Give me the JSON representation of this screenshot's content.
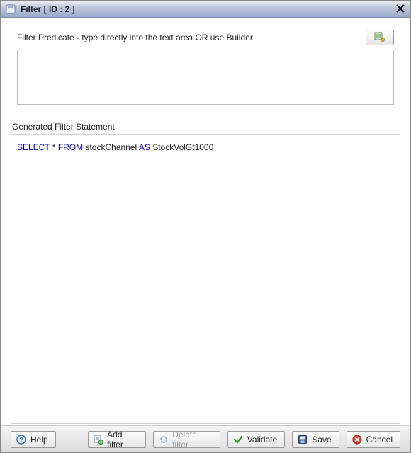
{
  "window": {
    "title": "Filter  [ ID : 2 ]"
  },
  "predicate": {
    "label": "Filter Predicate - type directly into the text area OR use Builder",
    "value": ""
  },
  "statement": {
    "label": "Generated Filter Statement",
    "token_select": "SELECT",
    "token_star_from": " * ",
    "token_from": "FROM",
    "token_src": " stockChannel ",
    "token_as": "AS",
    "token_alias": " StockVolGt1000"
  },
  "buttons": {
    "help": "Help",
    "add_filter": "Add filter",
    "delete_filter": "Delete filter",
    "validate": "Validate",
    "save": "Save",
    "cancel": "Cancel"
  },
  "colors": {
    "keyword": "#0000cc"
  }
}
